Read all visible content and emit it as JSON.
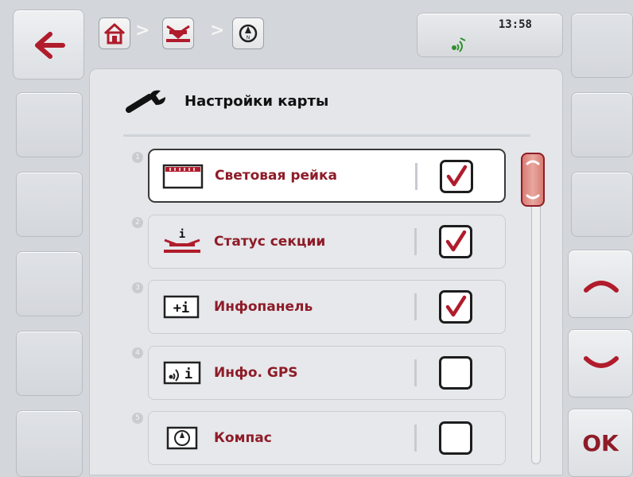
{
  "header": {
    "breadcrumb": [
      {
        "icon": "home-icon"
      },
      {
        "icon": "sprayer-icon"
      },
      {
        "icon": "compass-icon"
      }
    ],
    "separator": ">",
    "time": "13:58",
    "gps_status_icon": "gps-signal-icon"
  },
  "page": {
    "title": "Настройки карты",
    "title_icon": "wrench-icon"
  },
  "list": {
    "items": [
      {
        "number": "1",
        "icon": "lightbar-icon",
        "label": "Световая рейка",
        "checked": true,
        "selected": true
      },
      {
        "number": "2",
        "icon": "section-status-icon",
        "label": "Статус секции",
        "checked": true,
        "selected": false
      },
      {
        "number": "3",
        "icon": "infopanel-icon",
        "label": "Инфопанель",
        "checked": true,
        "selected": false
      },
      {
        "number": "4",
        "icon": "gps-info-icon",
        "label": "Инфо. GPS",
        "checked": false,
        "selected": false
      },
      {
        "number": "5",
        "icon": "compass-icon",
        "label": "Компас",
        "checked": false,
        "selected": false
      }
    ]
  },
  "side": {
    "ok_label": "OK"
  },
  "colors": {
    "accent": "#8e1c28",
    "gps_green": "#2f8f2f",
    "background": "#d3d6da"
  }
}
